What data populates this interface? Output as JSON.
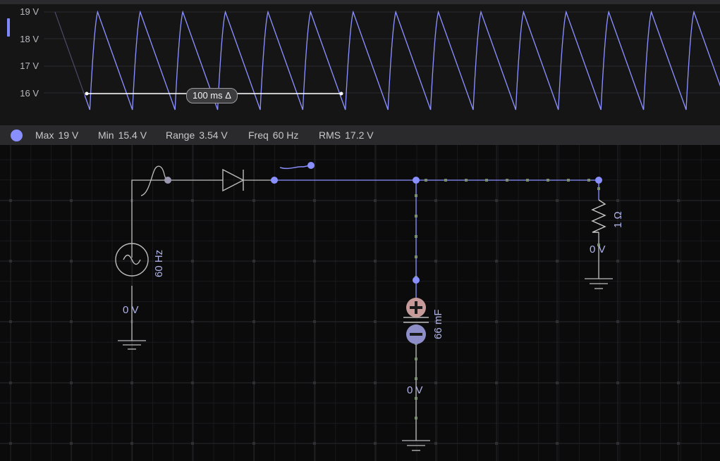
{
  "scope": {
    "y_labels": [
      "19 V",
      "18 V",
      "17 V",
      "16 V"
    ],
    "delta_label": "100 ms Δ",
    "trace_color": "#8a8fff",
    "stats": {
      "max_label": "Max",
      "max_value": "19 V",
      "min_label": "Min",
      "min_value": "15.4 V",
      "range_label": "Range",
      "range_value": "3.54 V",
      "freq_label": "Freq",
      "freq_value": "60 Hz",
      "rms_label": "RMS",
      "rms_value": "17.2 V"
    }
  },
  "circuit": {
    "source_freq": "60 Hz",
    "source_voltage": "0 V",
    "resistor_value": "1 Ω",
    "resistor_voltage": "0 V",
    "capacitor_value": "66 mF",
    "capacitor_voltage": "0 V",
    "wire_color": "#8a8fff",
    "component_color": "#bdbdbd"
  }
}
